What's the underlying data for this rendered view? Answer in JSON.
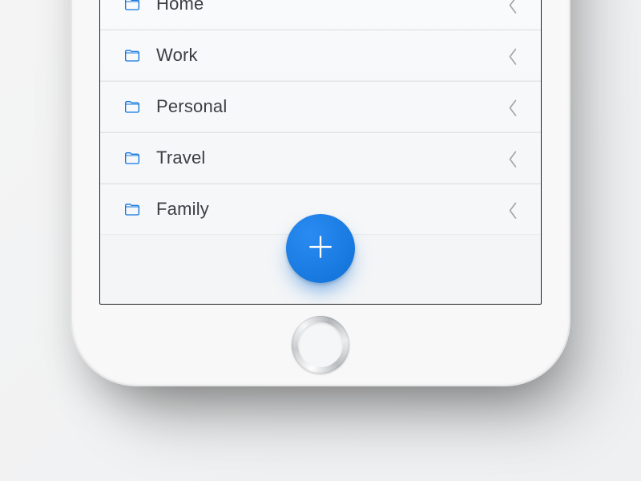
{
  "folders": [
    {
      "label": "Home"
    },
    {
      "label": "Work"
    },
    {
      "label": "Personal"
    },
    {
      "label": "Travel"
    },
    {
      "label": "Family"
    }
  ],
  "colors": {
    "accent": "#1276dd",
    "text": "#3b3f44",
    "chevron": "#8c8f93"
  },
  "icons": {
    "folder": "folder-icon",
    "chevron": "chevron-left-icon",
    "add": "plus-icon"
  }
}
